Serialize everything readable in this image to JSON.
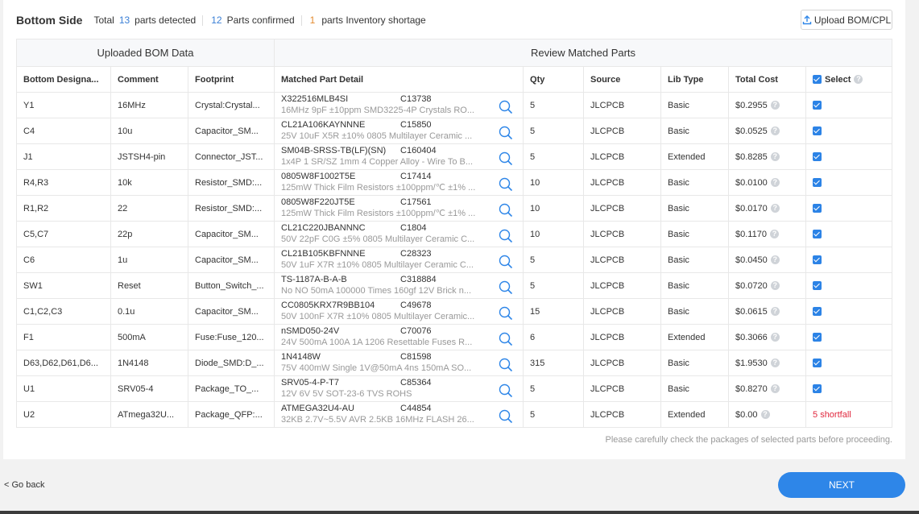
{
  "header": {
    "title": "Bottom Side",
    "total_label": "Total",
    "total_count": "13",
    "detected_label": "parts detected",
    "confirmed_count": "12",
    "confirmed_label": "Parts confirmed",
    "shortage_count": "1",
    "shortage_label": "parts Inventory shortage",
    "upload_button": "Upload BOM/CPL"
  },
  "table": {
    "group_left": "Uploaded BOM Data",
    "group_right": "Review Matched Parts",
    "columns": {
      "designator": "Bottom Designa...",
      "comment": "Comment",
      "footprint": "Footprint",
      "matched": "Matched Part Detail",
      "qty": "Qty",
      "source": "Source",
      "lib_type": "Lib Type",
      "total_cost": "Total Cost",
      "select": "Select"
    },
    "rows": [
      {
        "designator": "Y1",
        "comment": "16MHz",
        "footprint": "Crystal:Crystal...",
        "part_number": "X322516MLB4SI",
        "lcsc": "C13738",
        "description": "16MHz 9pF ±10ppm SMD3225-4P Crystals RO...",
        "qty": "5",
        "source": "JLCPCB",
        "lib_type": "Basic",
        "cost": "$0.2955",
        "selected": true
      },
      {
        "designator": "C4",
        "comment": "10u",
        "footprint": "Capacitor_SM...",
        "part_number": "CL21A106KAYNNNE",
        "lcsc": "C15850",
        "description": "25V 10uF X5R ±10% 0805 Multilayer Ceramic ...",
        "qty": "5",
        "source": "JLCPCB",
        "lib_type": "Basic",
        "cost": "$0.0525",
        "selected": true
      },
      {
        "designator": "J1",
        "comment": "JSTSH4-pin",
        "footprint": "Connector_JST...",
        "part_number": "SM04B-SRSS-TB(LF)(SN)",
        "lcsc": "C160404",
        "description": "1x4P 1 SR/SZ 1mm 4 Copper Alloy - Wire To B...",
        "qty": "5",
        "source": "JLCPCB",
        "lib_type": "Extended",
        "cost": "$0.8285",
        "selected": true
      },
      {
        "designator": "R4,R3",
        "comment": "10k",
        "footprint": "Resistor_SMD:...",
        "part_number": "0805W8F1002T5E",
        "lcsc": "C17414",
        "description": "125mW Thick Film Resistors ±100ppm/℃ ±1% ...",
        "qty": "10",
        "source": "JLCPCB",
        "lib_type": "Basic",
        "cost": "$0.0100",
        "selected": true
      },
      {
        "designator": "R1,R2",
        "comment": "22",
        "footprint": "Resistor_SMD:...",
        "part_number": "0805W8F220JT5E",
        "lcsc": "C17561",
        "description": "125mW Thick Film Resistors ±100ppm/℃ ±1% ...",
        "qty": "10",
        "source": "JLCPCB",
        "lib_type": "Basic",
        "cost": "$0.0170",
        "selected": true
      },
      {
        "designator": "C5,C7",
        "comment": "22p",
        "footprint": "Capacitor_SM...",
        "part_number": "CL21C220JBANNNC",
        "lcsc": "C1804",
        "description": "50V 22pF C0G ±5% 0805 Multilayer Ceramic C...",
        "qty": "10",
        "source": "JLCPCB",
        "lib_type": "Basic",
        "cost": "$0.1170",
        "selected": true
      },
      {
        "designator": "C6",
        "comment": "1u",
        "footprint": "Capacitor_SM...",
        "part_number": "CL21B105KBFNNNE",
        "lcsc": "C28323",
        "description": "50V 1uF X7R ±10% 0805 Multilayer Ceramic C...",
        "qty": "5",
        "source": "JLCPCB",
        "lib_type": "Basic",
        "cost": "$0.0450",
        "selected": true
      },
      {
        "designator": "SW1",
        "comment": "Reset",
        "footprint": "Button_Switch_...",
        "part_number": "TS-1187A-B-A-B",
        "lcsc": "C318884",
        "description": "No NO 50mA 100000 Times 160gf 12V Brick n...",
        "qty": "5",
        "source": "JLCPCB",
        "lib_type": "Basic",
        "cost": "$0.0720",
        "selected": true
      },
      {
        "designator": "C1,C2,C3",
        "comment": "0.1u",
        "footprint": "Capacitor_SM...",
        "part_number": "CC0805KRX7R9BB104",
        "lcsc": "C49678",
        "description": "50V 100nF X7R ±10% 0805 Multilayer Ceramic...",
        "qty": "15",
        "source": "JLCPCB",
        "lib_type": "Basic",
        "cost": "$0.0615",
        "selected": true
      },
      {
        "designator": "F1",
        "comment": "500mA",
        "footprint": "Fuse:Fuse_120...",
        "part_number": "nSMD050-24V",
        "lcsc": "C70076",
        "description": "24V 500mA 100A 1A 1206 Resettable Fuses R...",
        "qty": "6",
        "source": "JLCPCB",
        "lib_type": "Extended",
        "cost": "$0.3066",
        "selected": true
      },
      {
        "designator": "D63,D62,D61,D6...",
        "comment": "1N4148",
        "footprint": "Diode_SMD:D_...",
        "part_number": "1N4148W",
        "lcsc": "C81598",
        "description": "75V 400mW Single 1V@50mA 4ns 150mA SO...",
        "qty": "315",
        "source": "JLCPCB",
        "lib_type": "Basic",
        "cost": "$1.9530",
        "selected": true
      },
      {
        "designator": "U1",
        "comment": "SRV05-4",
        "footprint": "Package_TO_...",
        "part_number": "SRV05-4-P-T7",
        "lcsc": "C85364",
        "description": "12V 6V 5V SOT-23-6 TVS ROHS",
        "qty": "5",
        "source": "JLCPCB",
        "lib_type": "Basic",
        "cost": "$0.8270",
        "selected": true
      },
      {
        "designator": "U2",
        "comment": "ATmega32U...",
        "footprint": "Package_QFP:...",
        "part_number": "ATMEGA32U4-AU",
        "lcsc": "C44854",
        "description": "32KB 2.7V~5.5V AVR 2.5KB 16MHz FLASH 26...",
        "qty": "5",
        "source": "JLCPCB",
        "lib_type": "Extended",
        "cost": "$0.00",
        "selected": false,
        "status": "5 shortfall"
      }
    ]
  },
  "note": "Please carefully check the packages of selected parts before proceeding.",
  "footer": {
    "back": "< Go back",
    "next": "NEXT"
  },
  "colors": {
    "accent": "#2e86e8",
    "count_blue": "#3a7fd6",
    "warning_orange": "#e38a2e",
    "error_red": "#e0273d"
  }
}
